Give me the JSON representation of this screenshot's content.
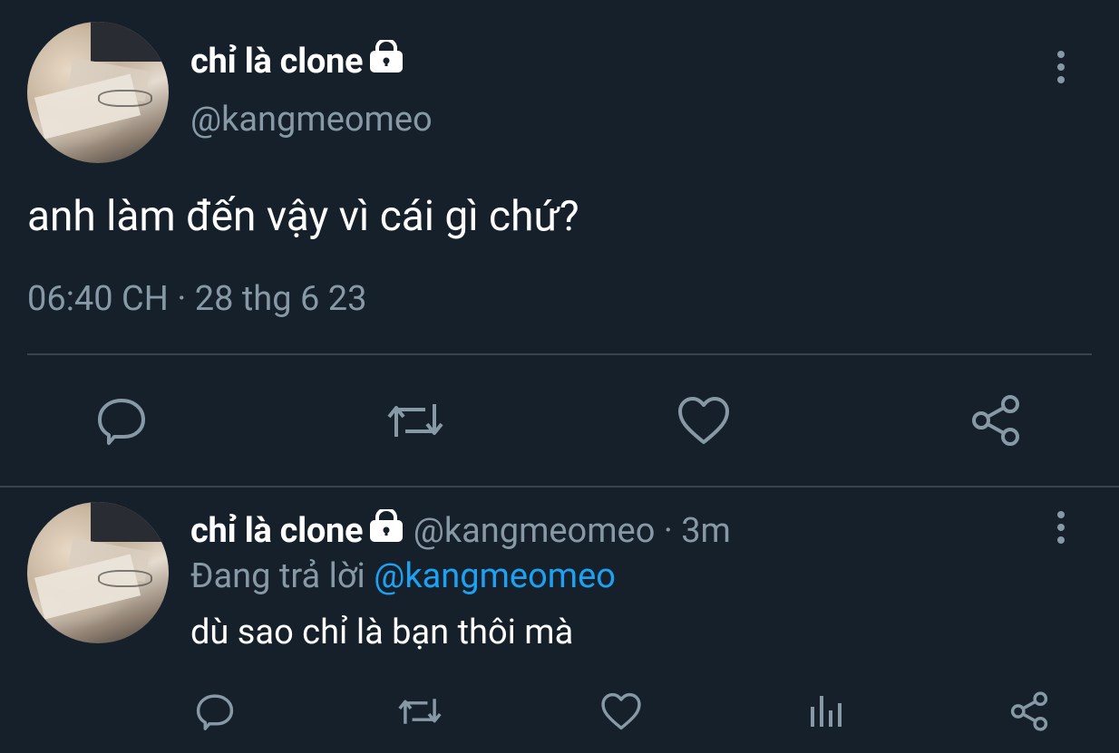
{
  "main_tweet": {
    "display_name": "chỉ là clone",
    "handle": "@kangmeomeo",
    "text": "anh làm đến vậy vì cái gì chứ?",
    "time": "06:40 CH",
    "separator": "·",
    "date": "28 thg 6 23",
    "actions": [
      "reply-icon",
      "retweet-icon",
      "like-icon",
      "share-icon"
    ]
  },
  "reply_tweet": {
    "display_name": "chỉ là clone",
    "handle": "@kangmeomeo",
    "separator": "·",
    "age": "3m",
    "replying_prefix": "Đang trả lời",
    "replying_to": "@kangmeomeo",
    "text": "dù sao chỉ là bạn thôi mà",
    "actions": [
      "reply-icon",
      "retweet-icon",
      "like-icon",
      "analytics-icon",
      "share-icon"
    ]
  },
  "colors": {
    "background": "#15202b",
    "text": "#ffffff",
    "muted": "#8899a6",
    "link": "#1da1f2",
    "divider": "#38444d"
  }
}
